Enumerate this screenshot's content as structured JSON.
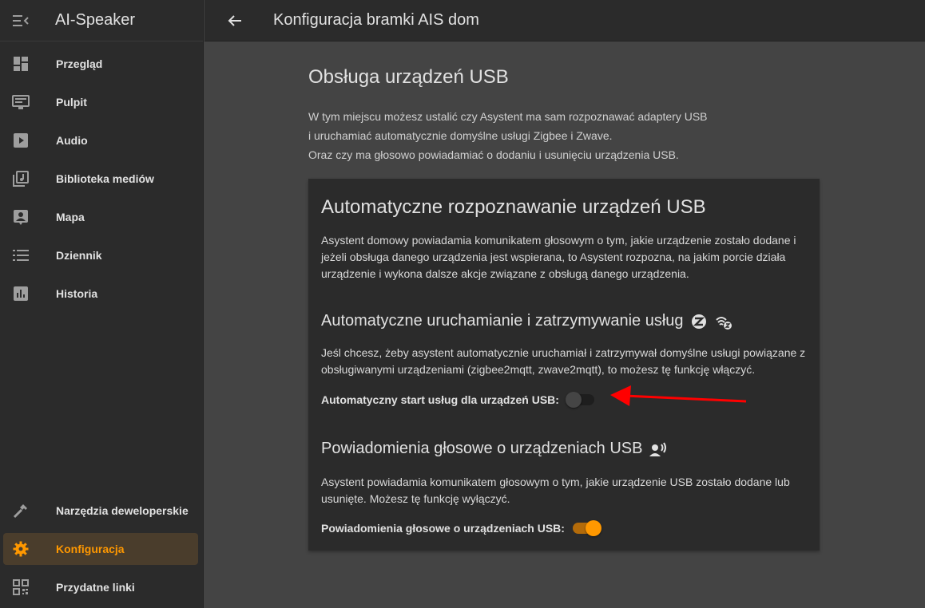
{
  "sidebar": {
    "title": "AI-Speaker",
    "items": [
      {
        "label": "Przegląd"
      },
      {
        "label": "Pulpit"
      },
      {
        "label": "Audio"
      },
      {
        "label": "Biblioteka mediów"
      },
      {
        "label": "Mapa"
      },
      {
        "label": "Dziennik"
      },
      {
        "label": "Historia"
      },
      {
        "label": "Narzędzia deweloperskie"
      },
      {
        "label": "Konfiguracja"
      },
      {
        "label": "Przydatne linki"
      }
    ]
  },
  "topbar": {
    "title": "Konfiguracja bramki AIS dom"
  },
  "main": {
    "title": "Obsługa urządzeń USB",
    "intro": [
      "W tym miejscu możesz ustalić czy Asystent ma sam rozpoznawać adaptery USB",
      "i uruchamiać automatycznie domyślne usługi Zigbee i Zwave.",
      "Oraz czy ma głosowo powiadamiać o dodaniu i usunięciu urządzenia USB."
    ]
  },
  "card": {
    "title": "Automatyczne rozpoznawanie urządzeń USB",
    "description": "Asystent domowy powiadamia komunikatem głosowym o tym, jakie urządzenie zostało dodane i jeżeli obsługa danego urządzenia jest wspierana, to Asystent rozpozna, na jakim porcie działa urządzenie i wykona dalsze akcje związane z obsługą danego urządzenia.",
    "section1": {
      "title": "Automatyczne uruchamianie i zatrzymywanie usług",
      "text": "Jeśl chcesz, żeby asystent automatycznie uruchamiał i zatrzymywał domyślne usługi powiązane z obsługiwanymi urządzeniami (zigbee2mqtt, zwave2mqtt), to możesz tę funkcję włączyć.",
      "switch_label": "Automatyczny start usług dla urządzeń USB:",
      "switch_on": false
    },
    "section2": {
      "title": "Powiadomienia głosowe o urządzeniach USB",
      "text": "Asystent powiadamia komunikatem głosowym o tym, jakie urządzenie USB zostało dodane lub usunięte. Możesz tę funkcję wyłączyć.",
      "switch_label": "Powiadomienia głosowe o urządzeniach USB:",
      "switch_on": true
    }
  },
  "colors": {
    "accent": "#ff9800",
    "annotation_arrow": "#ff0000"
  }
}
